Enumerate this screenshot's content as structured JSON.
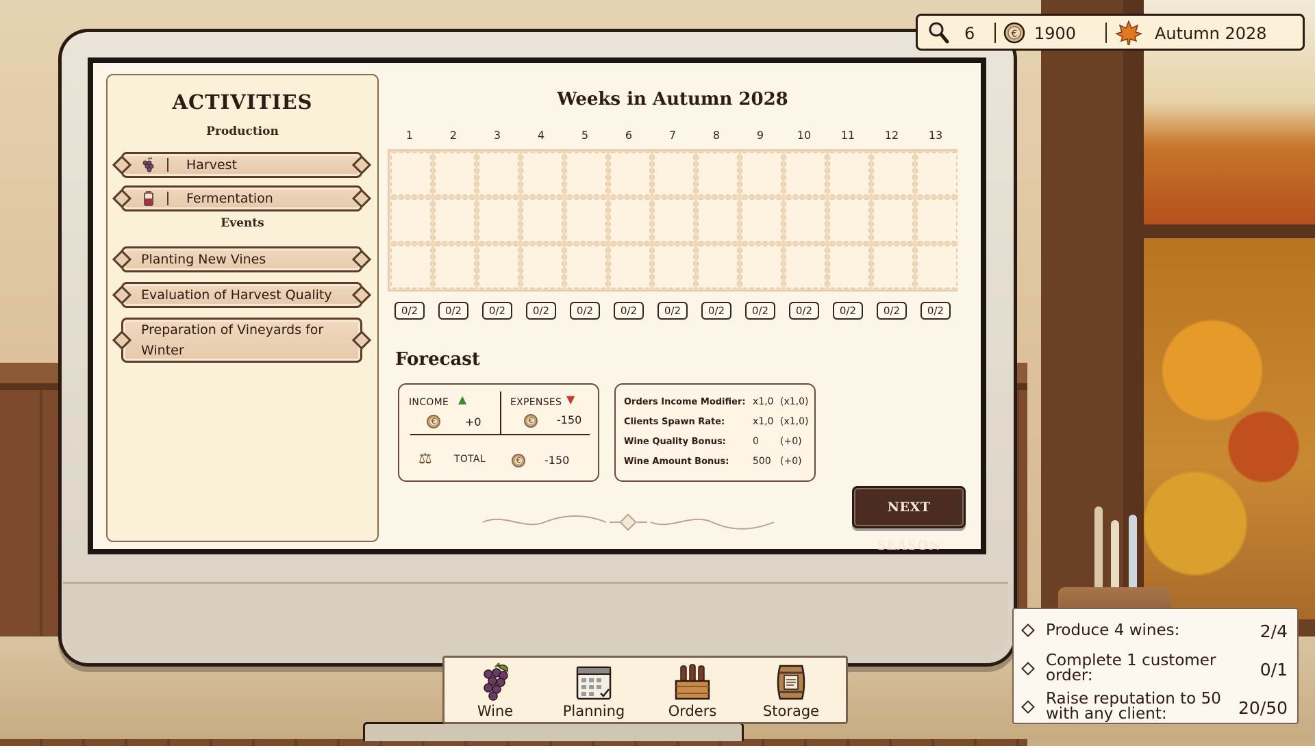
{
  "hud": {
    "reputation": "6",
    "money": "1900",
    "season": "Autumn 2028",
    "icons": {
      "reputation": "magnifier-icon",
      "money": "euro-coin-icon",
      "season": "maple-leaf-icon"
    }
  },
  "activities": {
    "title": "ACTIVITIES",
    "production_label": "Production",
    "production": [
      {
        "label": "Harvest",
        "icon": "grapes-icon"
      },
      {
        "label": "Fermentation",
        "icon": "fermentation-jar-icon"
      }
    ],
    "events_label": "Events",
    "events": [
      {
        "label": "Planting New Vines"
      },
      {
        "label": "Evaluation of Harvest Quality"
      },
      {
        "label": "Preparation of Vineyards for Winter"
      }
    ]
  },
  "weeks": {
    "title": "Weeks in Autumn 2028",
    "numbers": [
      "1",
      "2",
      "3",
      "4",
      "5",
      "6",
      "7",
      "8",
      "9",
      "10",
      "11",
      "12",
      "13"
    ],
    "capacity": [
      "0/2",
      "0/2",
      "0/2",
      "0/2",
      "0/2",
      "0/2",
      "0/2",
      "0/2",
      "0/2",
      "0/2",
      "0/2",
      "0/2",
      "0/2"
    ],
    "rows": 3
  },
  "forecast": {
    "title": "Forecast",
    "income_label": "INCOME",
    "income_value": "+0",
    "expenses_label": "EXPENSES",
    "expenses_value": "-150",
    "total_label": "TOTAL",
    "total_value": "-150",
    "stats": [
      {
        "label": "Orders Income Modifier:",
        "value": "x1,0",
        "modifier": "(x1,0)"
      },
      {
        "label": "Clients Spawn Rate:",
        "value": "x1,0",
        "modifier": "(x1,0)"
      },
      {
        "label": "Wine Quality Bonus:",
        "value": "0",
        "modifier": "(+0)"
      },
      {
        "label": "Wine Amount Bonus:",
        "value": "500",
        "modifier": "(+0)"
      }
    ]
  },
  "next_season_label": "NEXT SEASON",
  "nav": [
    {
      "label": "Wine",
      "icon": "grapes-icon"
    },
    {
      "label": "Planning",
      "icon": "calendar-icon"
    },
    {
      "label": "Orders",
      "icon": "wine-crate-icon"
    },
    {
      "label": "Storage",
      "icon": "barrel-icon"
    }
  ],
  "goals": [
    {
      "text": "Produce 4 wines:",
      "progress": "2/4"
    },
    {
      "text": "Complete 1 customer order:",
      "progress": "0/1"
    },
    {
      "text": "Raise reputation to 50 with any client:",
      "progress": "20/50"
    }
  ],
  "colors": {
    "accent_dark": "#4a2c22",
    "panel": "#fbf1d8",
    "button": "#e5c9aa",
    "income_arrow": "#3f8a2c",
    "expense_arrow": "#c8382a"
  }
}
